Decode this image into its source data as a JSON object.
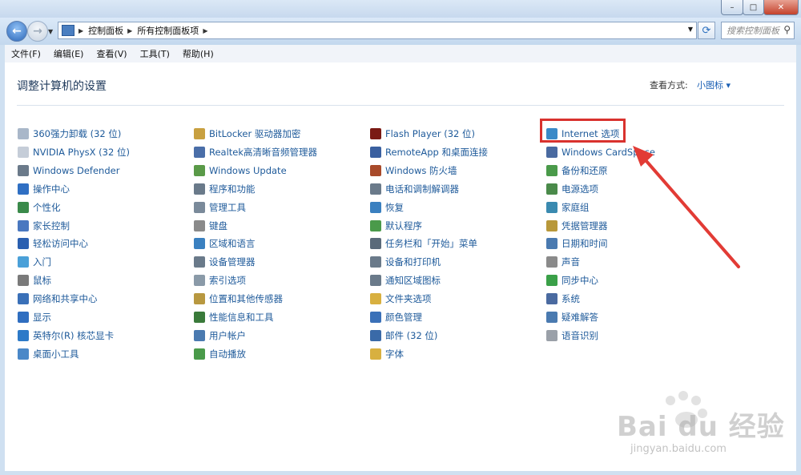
{
  "window": {
    "minimize": "–",
    "maximize": "□",
    "close": "✕"
  },
  "nav": {
    "breadcrumb": [
      "控制面板",
      "所有控制面板项"
    ],
    "search_placeholder": "搜索控制面板"
  },
  "menu": [
    "文件(F)",
    "编辑(E)",
    "查看(V)",
    "工具(T)",
    "帮助(H)"
  ],
  "page": {
    "heading": "调整计算机的设置",
    "view_by_label": "查看方式:",
    "view_by_value": "小图标 ▾"
  },
  "columns": [
    [
      {
        "label": "360强力卸载 (32 位)",
        "icon": "uninstall-icon",
        "color": "#a9b7c9"
      },
      {
        "label": "NVIDIA PhysX (32 位)",
        "icon": "document-icon",
        "color": "#c5cdd8"
      },
      {
        "label": "Windows Defender",
        "icon": "defender-icon",
        "color": "#6b7a8a"
      },
      {
        "label": "操作中心",
        "icon": "flag-icon",
        "color": "#2f6fc3"
      },
      {
        "label": "个性化",
        "icon": "personalization-icon",
        "color": "#3a8a4a"
      },
      {
        "label": "家长控制",
        "icon": "parental-control-icon",
        "color": "#4a78c0"
      },
      {
        "label": "轻松访问中心",
        "icon": "ease-of-access-icon",
        "color": "#2a5fb0"
      },
      {
        "label": "入门",
        "icon": "getting-started-icon",
        "color": "#4aa0d8"
      },
      {
        "label": "鼠标",
        "icon": "mouse-icon",
        "color": "#7a7a7a"
      },
      {
        "label": "网络和共享中心",
        "icon": "network-icon",
        "color": "#3a70b8"
      },
      {
        "label": "显示",
        "icon": "display-icon",
        "color": "#2f6ec0"
      },
      {
        "label": "英特尔(R) 核芯显卡",
        "icon": "intel-graphics-icon",
        "color": "#2d7ac8"
      },
      {
        "label": "桌面小工具",
        "icon": "gadgets-icon",
        "color": "#4a88c8"
      }
    ],
    [
      {
        "label": "BitLocker 驱动器加密",
        "icon": "bitlocker-icon",
        "color": "#c8a040"
      },
      {
        "label": "Realtek高清晰音频管理器",
        "icon": "realtek-audio-icon",
        "color": "#4a6ea8"
      },
      {
        "label": "Windows Update",
        "icon": "windows-update-icon",
        "color": "#5a9a48"
      },
      {
        "label": "程序和功能",
        "icon": "programs-icon",
        "color": "#6a7a8a"
      },
      {
        "label": "管理工具",
        "icon": "admin-tools-icon",
        "color": "#7a8a9a"
      },
      {
        "label": "键盘",
        "icon": "keyboard-icon",
        "color": "#8a8a8a"
      },
      {
        "label": "区域和语言",
        "icon": "region-language-icon",
        "color": "#3a80c0"
      },
      {
        "label": "设备管理器",
        "icon": "device-manager-icon",
        "color": "#6a7a8a"
      },
      {
        "label": "索引选项",
        "icon": "indexing-icon",
        "color": "#8a9aa8"
      },
      {
        "label": "位置和其他传感器",
        "icon": "location-sensor-icon",
        "color": "#b89840"
      },
      {
        "label": "性能信息和工具",
        "icon": "performance-icon",
        "color": "#3a7a3a"
      },
      {
        "label": "用户帐户",
        "icon": "user-accounts-icon",
        "color": "#4a7ab0"
      },
      {
        "label": "自动播放",
        "icon": "autoplay-icon",
        "color": "#4a9a4a"
      }
    ],
    [
      {
        "label": "Flash Player (32 位)",
        "icon": "flash-icon",
        "color": "#7a1a14"
      },
      {
        "label": "RemoteApp 和桌面连接",
        "icon": "remoteapp-icon",
        "color": "#3a60a0"
      },
      {
        "label": "Windows 防火墙",
        "icon": "firewall-icon",
        "color": "#a84a2a"
      },
      {
        "label": "电话和调制解调器",
        "icon": "phone-modem-icon",
        "color": "#6a7a8a"
      },
      {
        "label": "恢复",
        "icon": "recovery-icon",
        "color": "#3a80c0"
      },
      {
        "label": "默认程序",
        "icon": "default-programs-icon",
        "color": "#4a9a4a"
      },
      {
        "label": "任务栏和「开始」菜单",
        "icon": "taskbar-icon",
        "color": "#5a6a7a"
      },
      {
        "label": "设备和打印机",
        "icon": "printer-icon",
        "color": "#6a7a8a"
      },
      {
        "label": "通知区域图标",
        "icon": "notification-icon",
        "color": "#6a7a8a"
      },
      {
        "label": "文件夹选项",
        "icon": "folder-options-icon",
        "color": "#d8b040"
      },
      {
        "label": "颜色管理",
        "icon": "color-management-icon",
        "color": "#3a70b8"
      },
      {
        "label": "邮件 (32 位)",
        "icon": "mail-icon",
        "color": "#3a6aa8"
      },
      {
        "label": "字体",
        "icon": "fonts-icon",
        "color": "#d8b040"
      }
    ],
    [
      {
        "label": "Internet 选项",
        "icon": "internet-options-icon",
        "color": "#3a8ac8"
      },
      {
        "label": "Windows CardSpace",
        "icon": "cardspace-icon",
        "color": "#4a6aa0"
      },
      {
        "label": "备份和还原",
        "icon": "backup-restore-icon",
        "color": "#4a9a4a"
      },
      {
        "label": "电源选项",
        "icon": "power-options-icon",
        "color": "#4a8a4a"
      },
      {
        "label": "家庭组",
        "icon": "homegroup-icon",
        "color": "#3a8ab0"
      },
      {
        "label": "凭据管理器",
        "icon": "credential-manager-icon",
        "color": "#b8983a"
      },
      {
        "label": "日期和时间",
        "icon": "date-time-icon",
        "color": "#4a7ab0"
      },
      {
        "label": "声音",
        "icon": "sound-icon",
        "color": "#8a8a8a"
      },
      {
        "label": "同步中心",
        "icon": "sync-center-icon",
        "color": "#3aa048"
      },
      {
        "label": "系统",
        "icon": "system-icon",
        "color": "#4a6aa0"
      },
      {
        "label": "疑难解答",
        "icon": "troubleshooting-icon",
        "color": "#4a7ab0"
      },
      {
        "label": "语音识别",
        "icon": "speech-recognition-icon",
        "color": "#9aa0a8"
      }
    ]
  ],
  "watermark": {
    "text": "Bai du 经验",
    "url": "jingyan.baidu.com"
  },
  "colors": {
    "highlight": "#d9322e",
    "link": "#1e5a9a",
    "heading": "#1e395b"
  }
}
